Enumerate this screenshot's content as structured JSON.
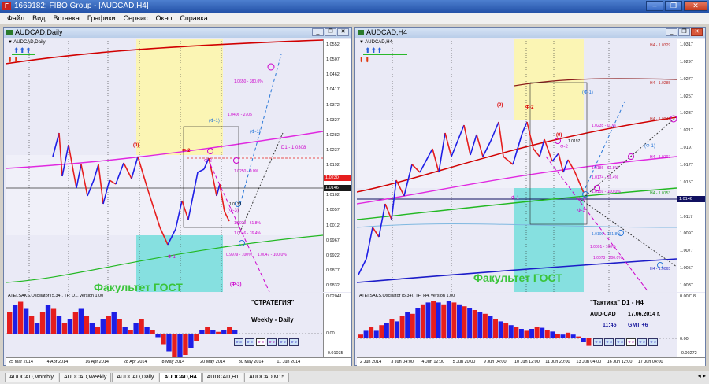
{
  "window": {
    "title": "1669182: FIBO Group - [AUDCAD,H4]",
    "app_icon": "F"
  },
  "menu": [
    "Файл",
    "Вид",
    "Вставка",
    "Графики",
    "Сервис",
    "Окно",
    "Справка"
  ],
  "left": {
    "title": "AUDCAD,Daily",
    "symbol": "▼ AUDCAD,Daily",
    "price_labels": [
      "1.0552",
      "1.0507",
      "1.0462",
      "1.0417",
      "1.0372",
      "1.0327",
      "1.0282",
      "1.0237",
      "1.0192",
      "1.0147",
      "1.0102",
      "1.0057",
      "1.0012",
      "0.9967",
      "0.9922",
      "0.9877",
      "0.9832"
    ],
    "current_price": "1.0146",
    "current_price2": "1.0230",
    "annotations": {
      "zero": "(0)",
      "phi1_blue": "(Ф-1)",
      "phi1_blue2": "(Ф-1)",
      "phi2_red": "Ф-2",
      "phi2_mag": "Ф-2",
      "phi3_paren": "(Ф-3)",
      "phi1_bottom": "Ф-1",
      "phi3_mid": "(Ф-3)",
      "d1": "D1 - 1.0308",
      "fib1": "1.0406 - 2705",
      "fib2": "1.0250 - 0.0%",
      "fib3": "1.0133",
      "fib4": "1.0022 - 61.8%",
      "fib5": "1.0046 - 76.4%",
      "fib6": "0.9979 - 100%",
      "fib7": "1.0047 - 100.0%",
      "fib8": "1.0650 - 380.0%"
    },
    "gost": "Факультет ГОСТ",
    "osc_title": "ATEI.SAKS.Oscillator (5.34), TF: D1, version 1.00",
    "osc_labels": [
      "0.02041",
      "0.00",
      "-0.01035"
    ],
    "strategy_title": "\"СТРАТЕГИЯ\"",
    "strategy_sub": "Weekly - Daily",
    "buttons": [
      "Ф-3",
      "Ф-3",
      "Ф-3",
      "Ф-2",
      "Ф-2",
      "Ф-2"
    ],
    "dates": [
      "25 Mar 2014",
      "4 Apr 2014",
      "16 Apr 2014",
      "28 Apr 2014",
      "8 May 2014",
      "20 May 2014",
      "30 May 2014",
      "11 Jun 2014"
    ]
  },
  "right": {
    "title": "AUDCAD,H4",
    "symbol": "▼ AUDCAD,H4",
    "price_labels": [
      "1.0317",
      "1.0297",
      "1.0277",
      "1.0257",
      "1.0237",
      "1.0217",
      "1.0197",
      "1.0177",
      "1.0157",
      "1.0137",
      "1.0117",
      "1.0097",
      "1.0077",
      "1.0057",
      "1.0037"
    ],
    "current_price": "1.0146",
    "h4_levels": [
      "H4 - 1.0329",
      "H4 - 1.0285",
      "H4 - 1.0242",
      "H4 - 1.0197",
      "H4 - 1.0153",
      "H4 - 1.0065"
    ],
    "annotations": {
      "zero_a": "(0)",
      "zero_b": "(0)",
      "phi2": "Ф-2",
      "phi2b": "Ф-2",
      "phi1_blue": "(Ф-1)",
      "phi1_blue2": "(Ф-1)",
      "phi1": "Ф-1",
      "phi3": "Ф-3",
      "phi3b": "Ф-3",
      "fib1": "1.0235 - 0.0%",
      "fib2": "1.0197",
      "fib3": "1.0186 - 61.8%",
      "fib4": "1.0174 - 76.4%",
      "fib5": "1.0159 - 100.0%",
      "fib6": "1.0100 - 161.8%",
      "fib7": "1.0091 - 100%",
      "fib8": "1.0073 - 200.0%"
    },
    "gost": "Факультет ГОСТ",
    "osc_title": "ATEI.SAKS.Oscillator (5.34), TF: H4, version 1.00",
    "osc_labels": [
      "0.00718",
      "0.00",
      "-0.00272"
    ],
    "tactic_title": "\"Тактика\"  D1 - H4",
    "pair": "AUD-CAD",
    "date": "17.06.2014  г.",
    "time": "11:45",
    "gmt": "GMT +6",
    "buttons": [
      "Ф-3",
      "Ф-3",
      "Ф-3",
      "Ф-2",
      "Ф-2",
      "Ф-2"
    ],
    "dates": [
      "2 Jun 2014",
      "3 Jun 04:00",
      "4 Jun 12:00",
      "5 Jun 20:00",
      "9 Jun 04:00",
      "10 Jun 12:00",
      "11 Jun 20:00",
      "13 Jun 04:00",
      "16 Jun 12:00",
      "17 Jun 04:00"
    ]
  },
  "tabs": [
    "AUDCAD,Monthly",
    "AUDCAD,Weekly",
    "AUDCAD,Daily",
    "AUDCAD,H4",
    "AUDCAD,H1",
    "AUDCAD,M15"
  ],
  "active_tab": "AUDCAD,H4",
  "colors": {
    "bull": "#1e1ee6",
    "bear": "#e61e1e",
    "ma_red": "#d10000",
    "ma_magenta": "#e028e0",
    "ma_green": "#22b822",
    "yellow_zone": "#fbf5b4",
    "cyan_zone": "#86e0e0"
  },
  "icons": [
    "app-icon",
    "minimize-icon",
    "restore-icon",
    "close-icon",
    "arrows-up-icon",
    "arrows-down-icon",
    "scroll-left-icon",
    "scroll-right-icon"
  ]
}
